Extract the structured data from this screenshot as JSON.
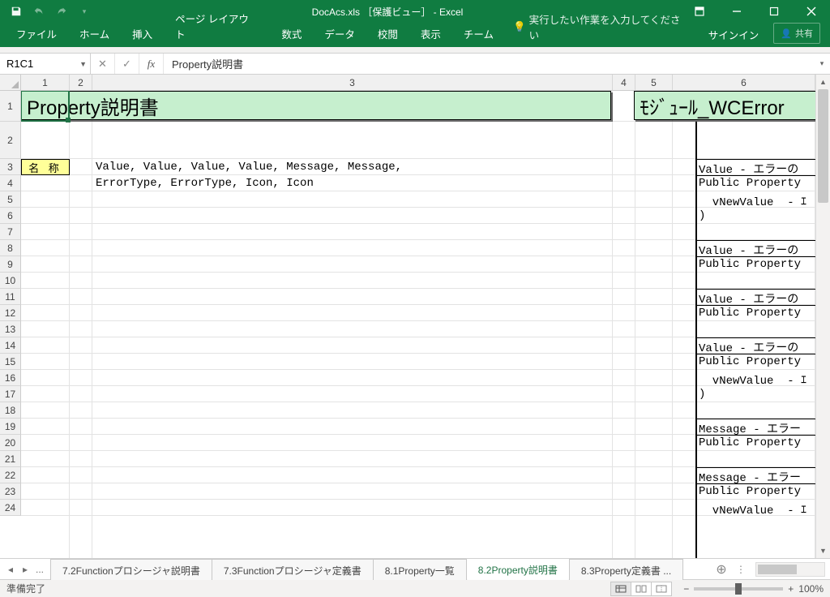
{
  "app": {
    "title": "DocAcs.xls ［保護ビュー］ - Excel"
  },
  "ribbon": {
    "tabs": [
      "ファイル",
      "ホーム",
      "挿入",
      "ページ レイアウト",
      "数式",
      "データ",
      "校閲",
      "表示",
      "チーム"
    ],
    "tellme": "実行したい作業を入力してください",
    "signin": "サインイン",
    "share": "共有"
  },
  "formula": {
    "namebox": "R1C1",
    "value": "Property説明書"
  },
  "columns": {
    "labels": [
      "1",
      "2",
      "3",
      "4",
      "5",
      "6"
    ],
    "widths": [
      60,
      28,
      642,
      28,
      46,
      176
    ]
  },
  "rows": {
    "labels": [
      "1",
      "2",
      "3",
      "4",
      "5",
      "6",
      "7",
      "8",
      "9",
      "10",
      "11",
      "12",
      "13",
      "14",
      "15",
      "16",
      "17",
      "18",
      "19",
      "20",
      "21",
      "22",
      "23",
      "24"
    ],
    "heights": [
      38,
      46,
      20,
      20,
      20,
      20,
      20,
      20,
      20,
      20,
      20,
      20,
      20,
      20,
      20,
      20,
      20,
      20,
      20,
      20,
      20,
      20,
      20,
      20
    ]
  },
  "sheet": {
    "title_cell": "Property説明書",
    "module_cell": "ﾓｼﾞｭｰﾙ_WCError",
    "name_label": "名 称",
    "row3": "Value, Value, Value, Value, Message, Message, ",
    "row4": "ErrorType, ErrorType, Icon, Icon",
    "right": {
      "r3": "Value - エラーの",
      "r4": "Public Property ",
      "r5": "  vNewValue  - ｴ",
      "r6": ")",
      "r8": "Value - エラーの",
      "r9": "Public Property ",
      "r11": "Value - エラーの",
      "r12": "Public Property ",
      "r14": "Value - エラーの",
      "r15": "Public Property ",
      "r16": "  vNewValue  - ｴ",
      "r17": ")",
      "r19": "Message - エラー",
      "r20": "Public Property ",
      "r22": "Message - エラー",
      "r23": "Public Property ",
      "r24": "  vNewValue  - ｴ"
    }
  },
  "tabs": {
    "prev_ellipsis": "...",
    "items": [
      {
        "label": "7.2Functionプロシージャ説明書",
        "active": false
      },
      {
        "label": "7.3Functionプロシージャ定義書",
        "active": false
      },
      {
        "label": "8.1Property一覧",
        "active": false
      },
      {
        "label": "8.2Property説明書",
        "active": true
      },
      {
        "label": "8.3Property定義書 ...",
        "active": false
      }
    ]
  },
  "status": {
    "ready": "準備完了",
    "zoom": "100%"
  }
}
